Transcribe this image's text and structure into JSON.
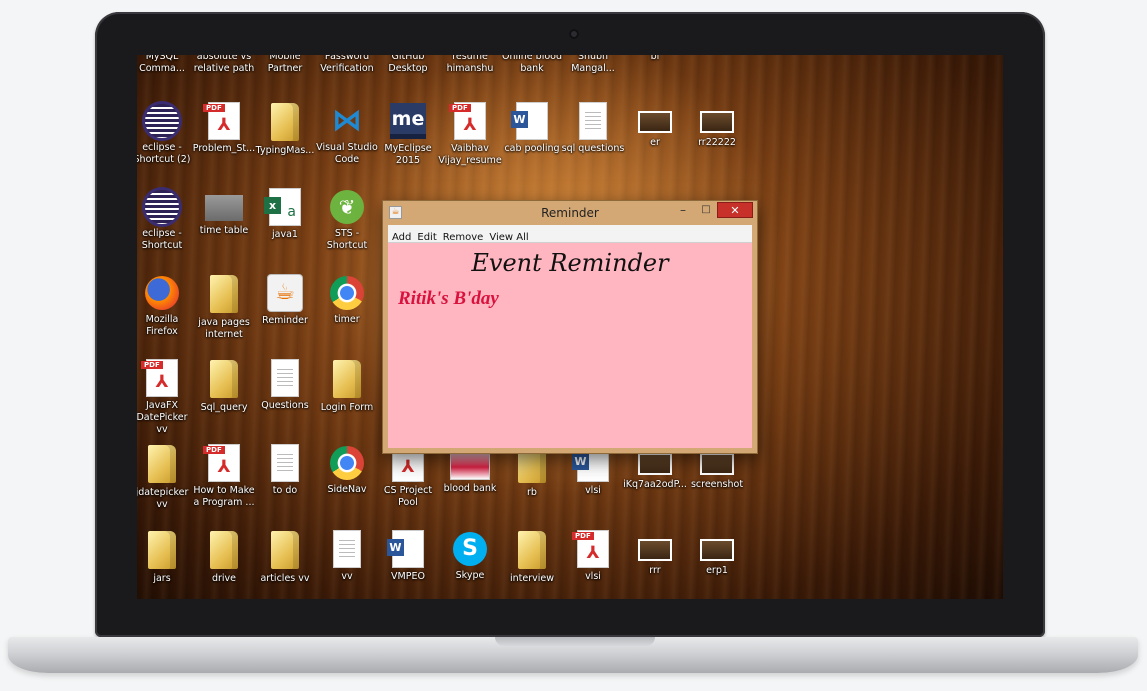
{
  "desktop": {
    "icons": [
      {
        "label": "MySQL\nComma...",
        "type": "doc"
      },
      {
        "label": "absolute vs\nrelative path",
        "type": "doc"
      },
      {
        "label": "Mobile\nPartner",
        "type": "doc"
      },
      {
        "label": "Password\nVerification",
        "type": "doc"
      },
      {
        "label": "GitHub\nDesktop",
        "type": "doc"
      },
      {
        "label": "resume\nhimanshu",
        "type": "doc"
      },
      {
        "label": "Online blood\nbank",
        "type": "doc"
      },
      {
        "label": "Shubh\nMangal...",
        "type": "doc"
      },
      {
        "label": "bl",
        "type": "doc"
      },
      {
        "label": "eclipse -\nShortcut (2)",
        "type": "eclipse"
      },
      {
        "label": "Problem_St...",
        "type": "pdf"
      },
      {
        "label": "TypingMas...",
        "type": "folder"
      },
      {
        "label": "Visual Studio\nCode",
        "type": "vscode"
      },
      {
        "label": "MyEclipse\n2015",
        "type": "me"
      },
      {
        "label": "Vaibhav\nVijay_resume",
        "type": "pdf"
      },
      {
        "label": "cab pooling",
        "type": "word"
      },
      {
        "label": "sql questions",
        "type": "doc"
      },
      {
        "label": "er",
        "type": "thumb"
      },
      {
        "label": "rr22222",
        "type": "thumb"
      },
      {
        "label": "eclipse -\nShortcut",
        "type": "eclipse"
      },
      {
        "label": "time table",
        "type": "grey"
      },
      {
        "label": "java1",
        "type": "excel"
      },
      {
        "label": "STS -\nShortcut",
        "type": "sts"
      },
      {
        "label": "Mozilla\nFirefox",
        "type": "firefox"
      },
      {
        "label": "java pages\ninternet",
        "type": "folder"
      },
      {
        "label": "Reminder",
        "type": "java"
      },
      {
        "label": "timer",
        "type": "chrome"
      },
      {
        "label": "JavaFX\nDatePicker vv",
        "type": "pdf"
      },
      {
        "label": "Sql_query",
        "type": "folder"
      },
      {
        "label": "Questions",
        "type": "doc"
      },
      {
        "label": "Login Form",
        "type": "folder"
      },
      {
        "label": "jdatepicker\nvv",
        "type": "folder"
      },
      {
        "label": "How to Make\na Program ...",
        "type": "pdf"
      },
      {
        "label": "to do",
        "type": "doc"
      },
      {
        "label": "SideNav",
        "type": "chrome"
      },
      {
        "label": "CS Project\nPool",
        "type": "pdf"
      },
      {
        "label": "blood bank",
        "type": "img"
      },
      {
        "label": "rb",
        "type": "folder"
      },
      {
        "label": "vlsi",
        "type": "word"
      },
      {
        "label": "iKq7aa2odP...",
        "type": "thumb"
      },
      {
        "label": "screenshot",
        "type": "thumb"
      },
      {
        "label": "jars",
        "type": "folder"
      },
      {
        "label": "drive",
        "type": "folder"
      },
      {
        "label": "articles vv",
        "type": "folder"
      },
      {
        "label": "vv",
        "type": "doc"
      },
      {
        "label": "VMPEO",
        "type": "word"
      },
      {
        "label": "Skype",
        "type": "skype"
      },
      {
        "label": "interview",
        "type": "folder"
      },
      {
        "label": "vlsi",
        "type": "pdf"
      },
      {
        "label": "rrr",
        "type": "thumb"
      },
      {
        "label": "erp1",
        "type": "thumb"
      }
    ]
  },
  "window": {
    "title": "Reminder",
    "minimize": "–",
    "maximize": "□",
    "close": "✕",
    "menu": [
      "Add",
      "Edit",
      "Remove",
      "View All"
    ],
    "heading": "Event Reminder",
    "event": "Ritik's B'day"
  },
  "pdf_tag": "PDF"
}
